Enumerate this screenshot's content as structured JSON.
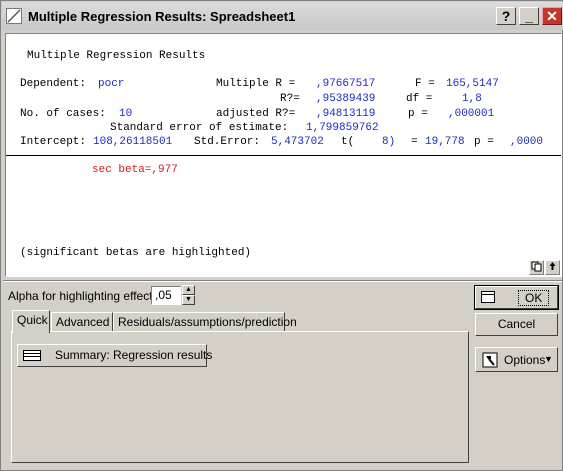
{
  "window": {
    "title": "Multiple Regression Results: Spreadsheet1"
  },
  "titlebar_buttons": {
    "help": "?",
    "minimize": "_",
    "close": "✕"
  },
  "results": {
    "heading": "Multiple Regression Results",
    "dependent_label": "Dependent:",
    "dependent_value": "pocr",
    "multiple_r_label": "Multiple R =",
    "multiple_r_value": ",97667517",
    "f_label": "F =",
    "f_value": "165,5147",
    "r2_label": "R?=",
    "r2_value": ",95389439",
    "df_label": "df =",
    "df_value": "1,8",
    "cases_label": "No. of cases:",
    "cases_value": "10",
    "adj_r2_label": "adjusted R?=",
    "adj_r2_value": ",94813119",
    "p_label": "p =",
    "p_value": ",000001",
    "se_estimate_label": "Standard error of estimate:",
    "se_estimate_value": "1,799859762",
    "intercept_label": "Intercept:",
    "intercept_value": "108,26118501",
    "std_error_label": "Std.Error:",
    "std_error_value": "5,473702",
    "t_label": "t(",
    "t_df": "8)",
    "t_eq": "=",
    "t_value": "19,778",
    "p2_label": "p =",
    "p2_value": ",0000",
    "beta_text": "sec beta=,977",
    "footnote": "(significant betas are highlighted)"
  },
  "controls": {
    "alpha_label": "Alpha for highlighting effects:",
    "alpha_value": ",05",
    "tabs": [
      "Quick",
      "Advanced",
      "Residuals/assumptions/prediction"
    ],
    "summary_button": "Summary:  Regression results",
    "ok_button": "OK",
    "cancel_button": "Cancel",
    "options_button": "Options"
  },
  "colors": {
    "value_blue": "#1c2bc4",
    "highlight_red": "#d01c1c",
    "close_red": "#c0392b"
  }
}
